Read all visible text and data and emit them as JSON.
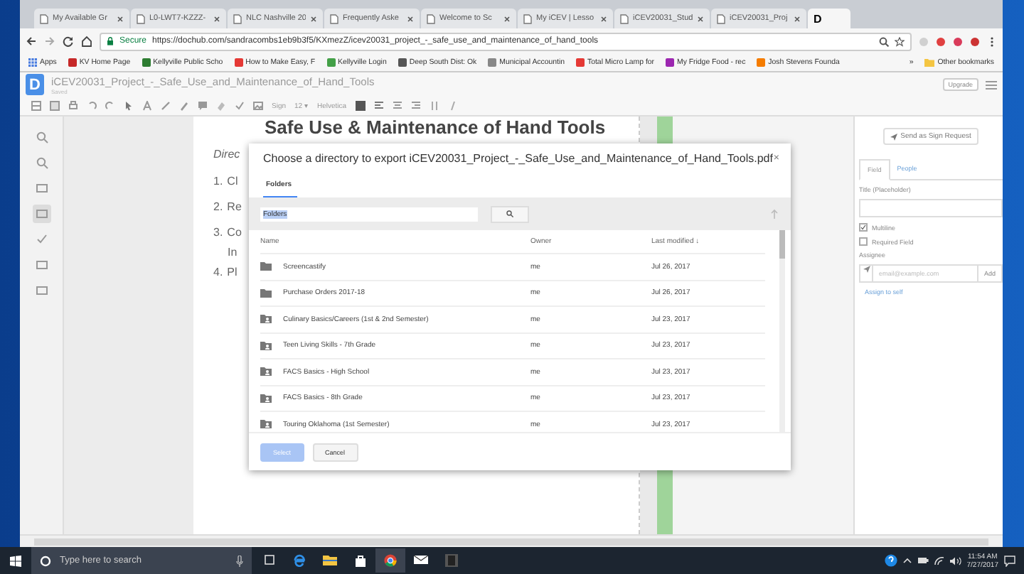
{
  "browser": {
    "tabs": [
      {
        "label": "My Available Gr",
        "selected": false
      },
      {
        "label": "L0-LWT7-KZZZ-",
        "selected": false
      },
      {
        "label": "NLC Nashville 20",
        "selected": false
      },
      {
        "label": "Frequently Aske",
        "selected": false
      },
      {
        "label": "Welcome to Sc",
        "selected": false
      },
      {
        "label": "My iCEV | Lesso",
        "selected": false
      },
      {
        "label": "iCEV20031_Stud",
        "selected": false
      },
      {
        "label": "iCEV20031_Proj",
        "selected": false
      },
      {
        "label": "D",
        "selected": true
      }
    ],
    "secure": "Secure",
    "url": "https://dochub.com/sandracombs1eb9b3f5/KXmezZ/icev20031_project_-_safe_use_and_maintenance_of_hand_tools",
    "bookmarks": [
      "Apps",
      "KV Home Page",
      "Kellyville Public Scho",
      "How to Make Easy, F",
      "Kellyville Login",
      "Deep South Dist: Ok",
      "Municipal Accountin",
      "Total Micro Lamp for",
      "My Fridge Food - rec",
      "Josh Stevens Founda"
    ],
    "more_bookmarks": "»",
    "other_bookmarks": "Other bookmarks"
  },
  "app": {
    "logo": "D",
    "title": "iCEV20031_Project_-_Safe_Use_and_Maintenance_of_Hand_Tools",
    "status": "Saved",
    "upgrade": "Upgrade",
    "toolbar": {
      "sign": "Sign",
      "font_size": "12",
      "font_size_caret": "▾",
      "font": "Helvetica"
    }
  },
  "document": {
    "heading": "Safe Use & Maintenance of Hand Tools",
    "lines": [
      {
        "text": "Direc"
      },
      {
        "number": "1.",
        "text": "Cl"
      },
      {
        "number": "2.",
        "text": "Re"
      },
      {
        "number": "3.",
        "text": "Co"
      },
      {
        "text": "In"
      },
      {
        "number": "4.",
        "text": "Pl"
      }
    ]
  },
  "dialog": {
    "title": "Choose a directory to export iCEV20031_Project_-_Safe_Use_and_Maintenance_of_Hand_Tools.pdf",
    "close": "×",
    "tabs": [
      {
        "label": "Folders",
        "selected": true
      }
    ],
    "search": {
      "value": "Folders"
    },
    "columns": [
      "Name",
      "Owner",
      "Last modified ↓"
    ],
    "rows": [
      {
        "kind": "folder",
        "name": "Screencastify",
        "owner": "me",
        "modified": "Jul 26, 2017"
      },
      {
        "kind": "folder",
        "name": "Purchase Orders 2017-18",
        "owner": "me",
        "modified": "Jul 26, 2017"
      },
      {
        "kind": "shared",
        "name": "Culinary Basics/Careers (1st & 2nd Semester)",
        "owner": "me",
        "modified": "Jul 23, 2017"
      },
      {
        "kind": "shared",
        "name": "Teen Living Skills - 7th Grade",
        "owner": "me",
        "modified": "Jul 23, 2017"
      },
      {
        "kind": "shared",
        "name": "FACS Basics - High School",
        "owner": "me",
        "modified": "Jul 23, 2017"
      },
      {
        "kind": "shared",
        "name": "FACS Basics - 8th Grade",
        "owner": "me",
        "modified": "Jul 23, 2017"
      },
      {
        "kind": "shared",
        "name": "Touring Oklahoma (1st Semester)",
        "owner": "me",
        "modified": "Jul 23, 2017"
      }
    ],
    "buttons": [
      {
        "label": "Select",
        "disabled": true
      },
      {
        "label": "Cancel",
        "disabled": false
      }
    ]
  },
  "sidebar": {
    "send": "Send as Sign Request",
    "tabs": [
      {
        "label": "Field",
        "selected": true
      },
      {
        "label": "People",
        "selected": false
      }
    ],
    "title_label": "Title (Placeholder)",
    "options": [
      {
        "label": "Multiline",
        "checked": true
      },
      {
        "label": "Required Field",
        "checked": false
      }
    ],
    "assignee_label": "Assignee",
    "assignee_placeholder": "email@example.com",
    "add": "Add",
    "assign_self": "Assign to self"
  },
  "taskbar": {
    "search_placeholder": "Type here to search",
    "time": "11:54 AM",
    "date": "7/27/2017"
  }
}
